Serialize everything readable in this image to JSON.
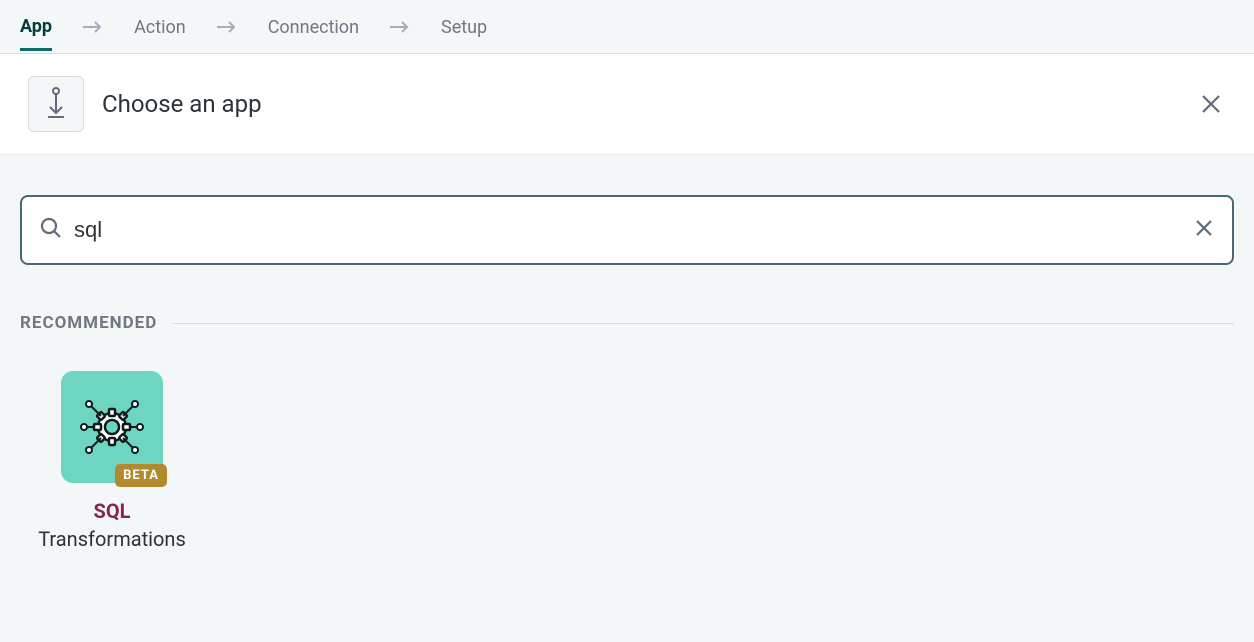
{
  "breadcrumb": {
    "items": [
      {
        "label": "App",
        "active": true
      },
      {
        "label": "Action",
        "active": false
      },
      {
        "label": "Connection",
        "active": false
      },
      {
        "label": "Setup",
        "active": false
      }
    ]
  },
  "header": {
    "title": "Choose an app"
  },
  "search": {
    "value": "sql",
    "placeholder": ""
  },
  "section": {
    "label": "RECOMMENDED"
  },
  "results": [
    {
      "badge": "BETA",
      "name_highlight": "SQL",
      "name_rest": " Transformations"
    }
  ]
}
